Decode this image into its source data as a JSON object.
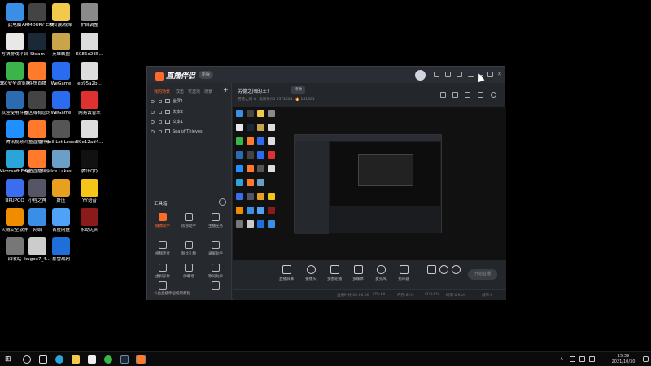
{
  "desktop_icons": [
    {
      "label": "此电脑",
      "color": "#3a8ee6"
    },
    {
      "label": "ARMOURY CRATE",
      "color": "#444"
    },
    {
      "label": "腾讯影视库",
      "color": "#f2c94c"
    },
    {
      "label": "护目调整",
      "color": "#8a8a8a"
    },
    {
      "label": "方块游戏平台",
      "color": "#e8e8e8"
    },
    {
      "label": "Steam",
      "color": "#1b2838"
    },
    {
      "label": "英雄联盟",
      "color": "#c8a54b"
    },
    {
      "label": "6086d285...",
      "color": "#ddd"
    },
    {
      "label": "360安全浏览器",
      "color": "#3bb54a"
    },
    {
      "label": "斗鱼直播",
      "color": "#ff7a2b"
    },
    {
      "label": "WeGame",
      "color": "#2a6cf0"
    },
    {
      "label": "eb95a2b...",
      "color": "#ddd"
    },
    {
      "label": "欢迎使用斗鱼",
      "color": "#2b6cb0"
    },
    {
      "label": "本区域有您的",
      "color": "#444"
    },
    {
      "label": "WeGame",
      "color": "#2a6cf0"
    },
    {
      "label": "网易云音乐",
      "color": "#e03131"
    },
    {
      "label": "腾讯视频",
      "color": "#1e90ff"
    },
    {
      "label": "斗鱼直播伴侣",
      "color": "#ff7a2b"
    },
    {
      "label": "Hell Let Loose",
      "color": "#555"
    },
    {
      "label": "89e12ad4...",
      "color": "#ddd"
    },
    {
      "label": "Microsoft Edge",
      "color": "#2aa5d8"
    },
    {
      "label": "斗鱼直播伴侣",
      "color": "#ff7a2b"
    },
    {
      "label": "Ice Lakes",
      "color": "#6aa0c8"
    },
    {
      "label": "腾讯QQ",
      "color": "#111"
    },
    {
      "label": "UPUPOO",
      "color": "#3a6df0"
    },
    {
      "label": "小程之神",
      "color": "#556"
    },
    {
      "label": "好压",
      "color": "#e8a020"
    },
    {
      "label": "YY语音",
      "color": "#f5c518"
    },
    {
      "label": "火绒安全软件",
      "color": "#f08c00"
    },
    {
      "label": "网络",
      "color": "#3a8ee6"
    },
    {
      "label": "百度网盘",
      "color": "#4fa3f7"
    },
    {
      "label": "永劫无间",
      "color": "#8b1a1a"
    },
    {
      "label": "回收站",
      "color": "#777"
    },
    {
      "label": "kugou7_4...",
      "color": "#ccc"
    },
    {
      "label": "暴雪战网",
      "color": "#1e6fd9"
    }
  ],
  "app": {
    "logo": "直播伴侣",
    "badge": "新版",
    "sidebar_tabs": [
      "我的场景",
      "双击",
      "可选项",
      "场景"
    ],
    "scene_items": [
      "全屏1",
      "文本2",
      "文本1",
      "Sea of Thieves"
    ],
    "tools_title": "工具箱",
    "tools": [
      "摄像助手",
      "房管助手",
      "主播任务",
      "视频连麦",
      "粉丝礼物",
      "录屏助手",
      "虚拟形象",
      "弹幕墙",
      "歌词助手",
      "主播插件",
      "",
      ""
    ],
    "sidebar_note": "斗鱼直播伴侣使用教程",
    "room_title": "劳德之间的王!",
    "room_tag": "修改",
    "room_meta_left": "劳德之间 ⚙",
    "room_meta_id": "房间号/ID 5572401",
    "room_meta_heat": "🔥 181661",
    "controls": [
      "直播屏幕",
      "摄像头",
      "多图轮播",
      "多媒体",
      "麦克风",
      "扬声器"
    ],
    "go_live": "开始直播",
    "status_items": [
      "直播时长 00:00:00",
      "FPS:60",
      "内存:62%",
      "CPU:5%",
      "码率:0 Kb/s",
      "帧率:0"
    ]
  },
  "taskbar": {
    "time": "15:39",
    "date": "2021/10/30"
  }
}
